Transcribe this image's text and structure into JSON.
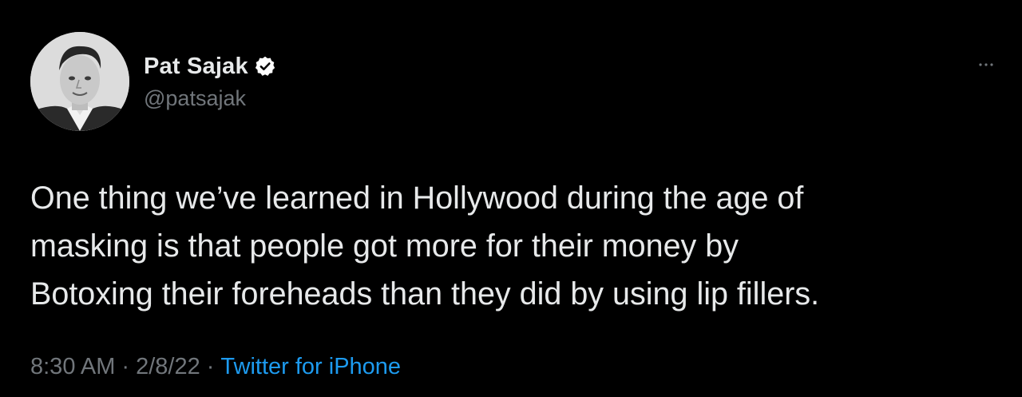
{
  "tweet": {
    "avatar_icon": "user-portrait-avatar",
    "display_name": "Pat Sajak",
    "verified_icon": "verified-badge-icon",
    "handle": "@patsajak",
    "more_icon": "more-horizontal-icon",
    "text": "One thing we’ve learned in Hollywood during the age of\nmasking is that people got more for their money by\nBotoxing their foreheads than they did by using lip fillers.",
    "time": "8:30 AM",
    "date": "2/8/22",
    "separator": "·",
    "source": "Twitter for iPhone"
  },
  "colors": {
    "background": "#000000",
    "primary_text": "#e7e9ea",
    "secondary_text": "#71767b",
    "accent_link": "#1d9bf0"
  }
}
